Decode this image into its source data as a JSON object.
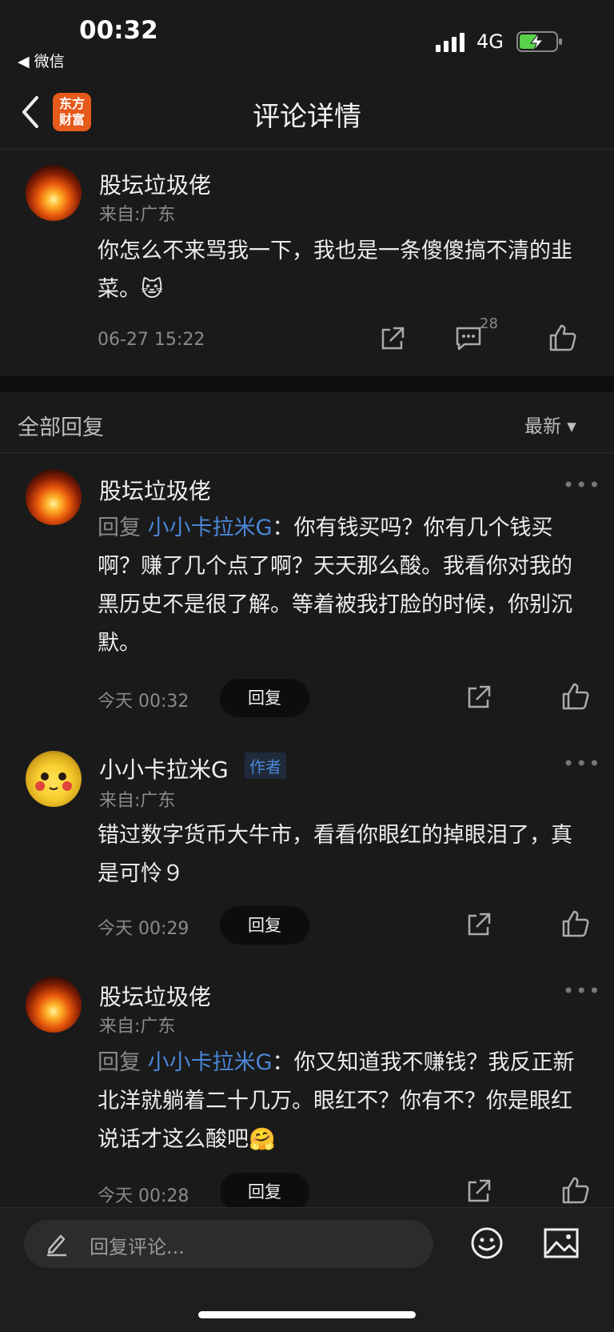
{
  "status_bar": {
    "time": "00:32",
    "back_app": "◀ 微信",
    "network": "4G"
  },
  "nav": {
    "logo_line1": "东方",
    "logo_line2": "财富",
    "title": "评论详情"
  },
  "main_comment": {
    "user": "股坛垃圾佬",
    "location": "来自:广东",
    "text": "你怎么不来骂我一下，我也是一条傻傻搞不清的韭菜。🐱",
    "time": "06-27 15:22",
    "reply_count": "28"
  },
  "replies_header": {
    "title": "全部回复",
    "sort": "最新 ▾"
  },
  "replies": [
    {
      "user": "股坛垃圾佬",
      "reply_prefix": "回复",
      "reply_to": "小小卡拉米G",
      "colon": "：",
      "text": "你有钱买吗？你有几个钱买啊？赚了几个点了啊？天天那么酸。我看你对我的黑历史不是很了解。等着被我打脸的时候，你别沉默。",
      "time": "今天 00:32",
      "reply_btn": "回复"
    },
    {
      "user": "小小卡拉米G",
      "author_tag": "作者",
      "location": "来自:广东",
      "text": "错过数字货币大牛市，看看你眼红的掉眼泪了，真是可怜９",
      "time": "今天 00:29",
      "reply_btn": "回复"
    },
    {
      "user": "股坛垃圾佬",
      "location": "来自:广东",
      "reply_prefix": "回复",
      "reply_to": "小小卡拉米G",
      "colon": "：",
      "text": "你又知道我不赚钱？我反正新北洋就躺着二十几万。眼红不？你有不？你是眼红说话才这么酸吧🤗",
      "time": "今天 00:28",
      "reply_btn": "回复"
    }
  ],
  "input": {
    "placeholder": "回复评论..."
  },
  "icons": {
    "edit": "pencil-icon",
    "emoji": "smiley-icon",
    "image": "image-icon",
    "share": "share-icon",
    "comment": "comment-icon",
    "like": "thumbs-up-icon",
    "back": "chevron-left-icon"
  },
  "colors": {
    "background": "#1a1a1a",
    "accent_blue": "#4a87d6",
    "logo_orange": "#e65a1c",
    "battery_green": "#5ad14b"
  }
}
